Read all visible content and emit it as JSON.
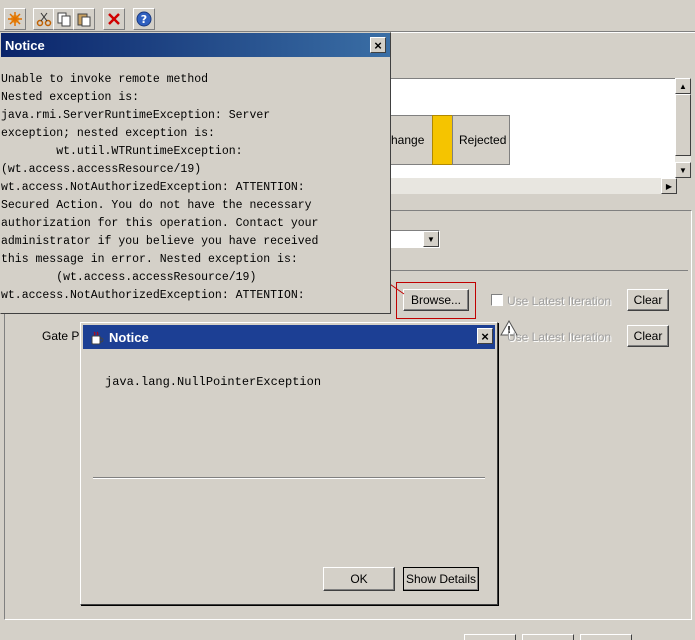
{
  "background": {
    "status": {
      "change_label": "hange",
      "rejected_label": "Rejected",
      "highlight_color": "#f5c400"
    },
    "browse_label": "Browse...",
    "use_latest_label_1": "Use Latest Iteration",
    "use_latest_label_2": "Use Latest Iteration",
    "clear_label_1": "Clear",
    "clear_label_2": "Clear",
    "gate_label": "Gate P"
  },
  "notice1": {
    "title": "Notice",
    "close": "×",
    "lines": [
      "Unable to invoke remote method",
      "Nested exception is:",
      "java.rmi.ServerRuntimeException: Server",
      "exception; nested exception is:",
      "        wt.util.WTRuntimeException:",
      "(wt.access.accessResource/19)",
      "wt.access.NotAuthorizedException: ATTENTION:",
      "Secured Action. You do not have the necessary",
      "authorization for this operation. Contact your",
      "administrator if you believe you have received",
      "this message in error. Nested exception is:",
      "        (wt.access.accessResource/19)",
      "wt.access.NotAuthorizedException: ATTENTION:"
    ]
  },
  "notice2": {
    "title": "Notice",
    "close": "×",
    "message": "java.lang.NullPointerException",
    "ok_label": "OK",
    "details_label": "Show Details"
  }
}
